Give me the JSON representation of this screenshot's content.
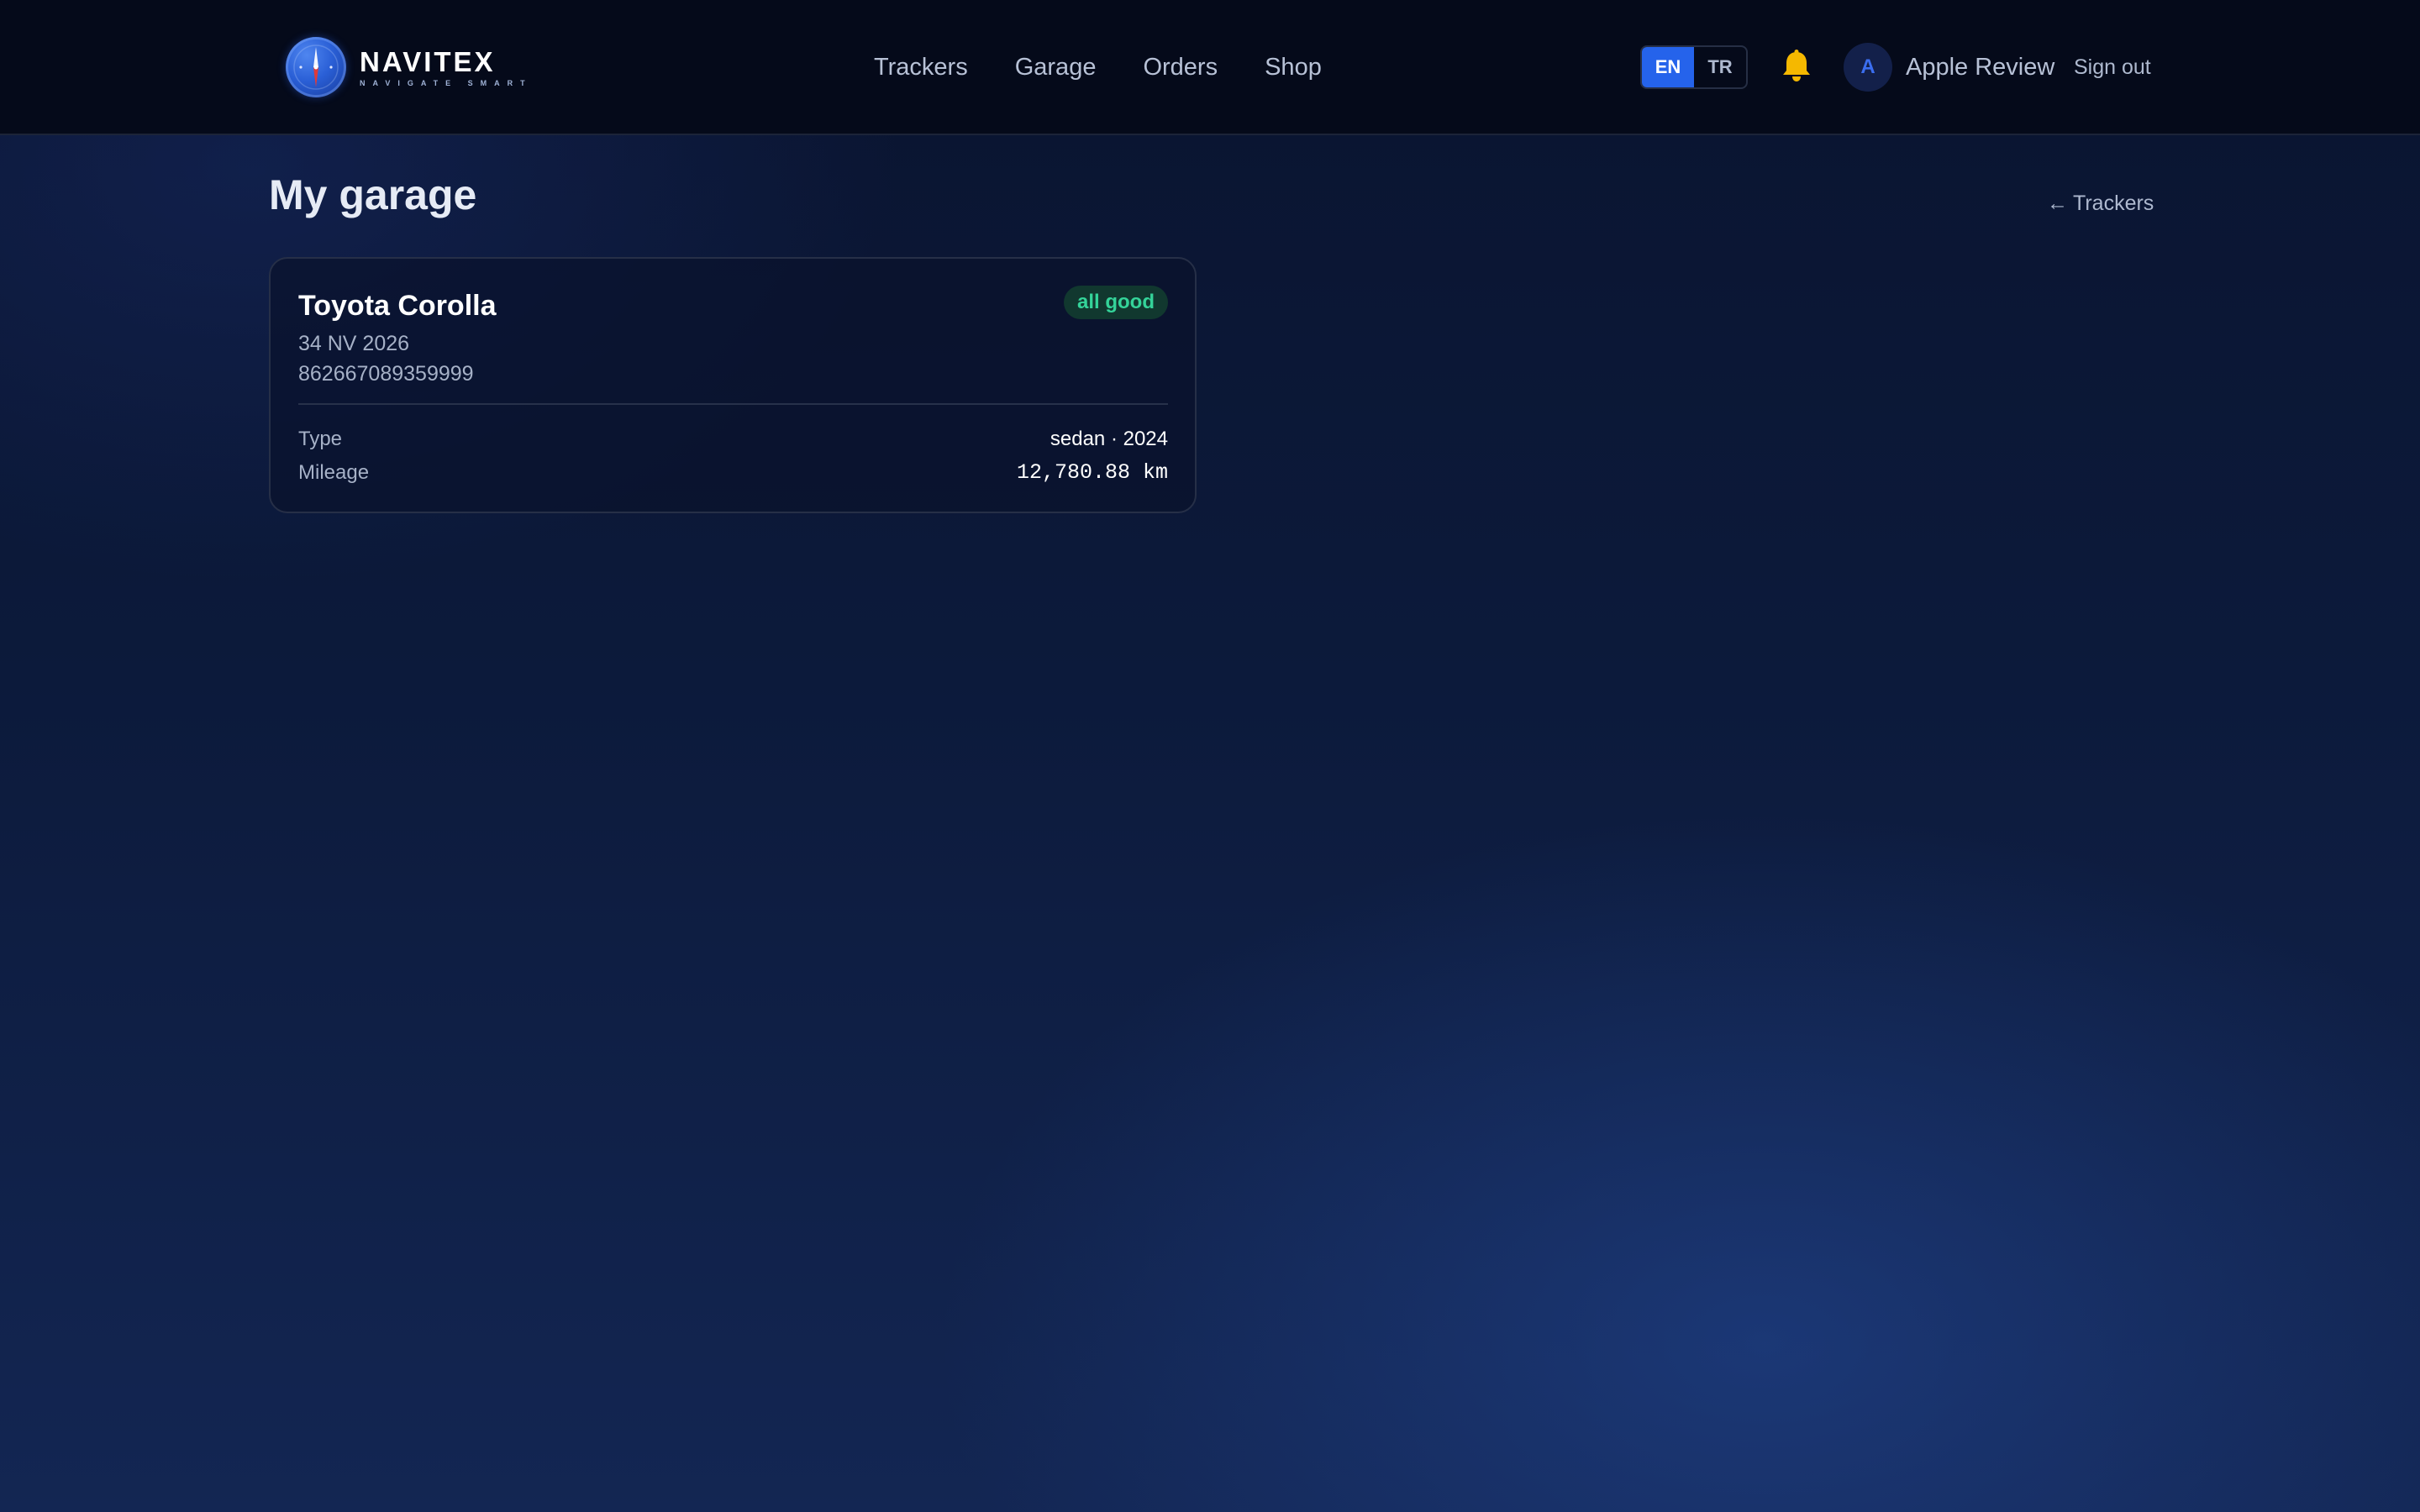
{
  "header": {
    "logo": {
      "name": "NAVITEX",
      "tagline": "NAVIGATE SMART"
    },
    "nav": [
      {
        "label": "Trackers"
      },
      {
        "label": "Garage"
      },
      {
        "label": "Orders"
      },
      {
        "label": "Shop"
      }
    ],
    "languages": [
      {
        "label": "EN",
        "active": true
      },
      {
        "label": "TR",
        "active": false
      }
    ],
    "notification_icon": "bell-icon",
    "user": {
      "initial": "A",
      "name": "Apple Review"
    },
    "sign_out_label": "Sign out"
  },
  "page": {
    "title": "My garage",
    "back_link": {
      "arrow": "←",
      "label": "Trackers"
    }
  },
  "vehicles": [
    {
      "name": "Toyota Corolla",
      "plate": "34 NV 2026",
      "device_id": "862667089359999",
      "status": "all good",
      "details": [
        {
          "label": "Type",
          "value": "sedan · 2024"
        },
        {
          "label": "Mileage",
          "value": "12,780.88 km"
        }
      ]
    }
  ],
  "colors": {
    "accent": "#2563eb",
    "status_good_text": "#34d399",
    "status_good_bg": "#11382f",
    "bell": "#f5b800"
  }
}
